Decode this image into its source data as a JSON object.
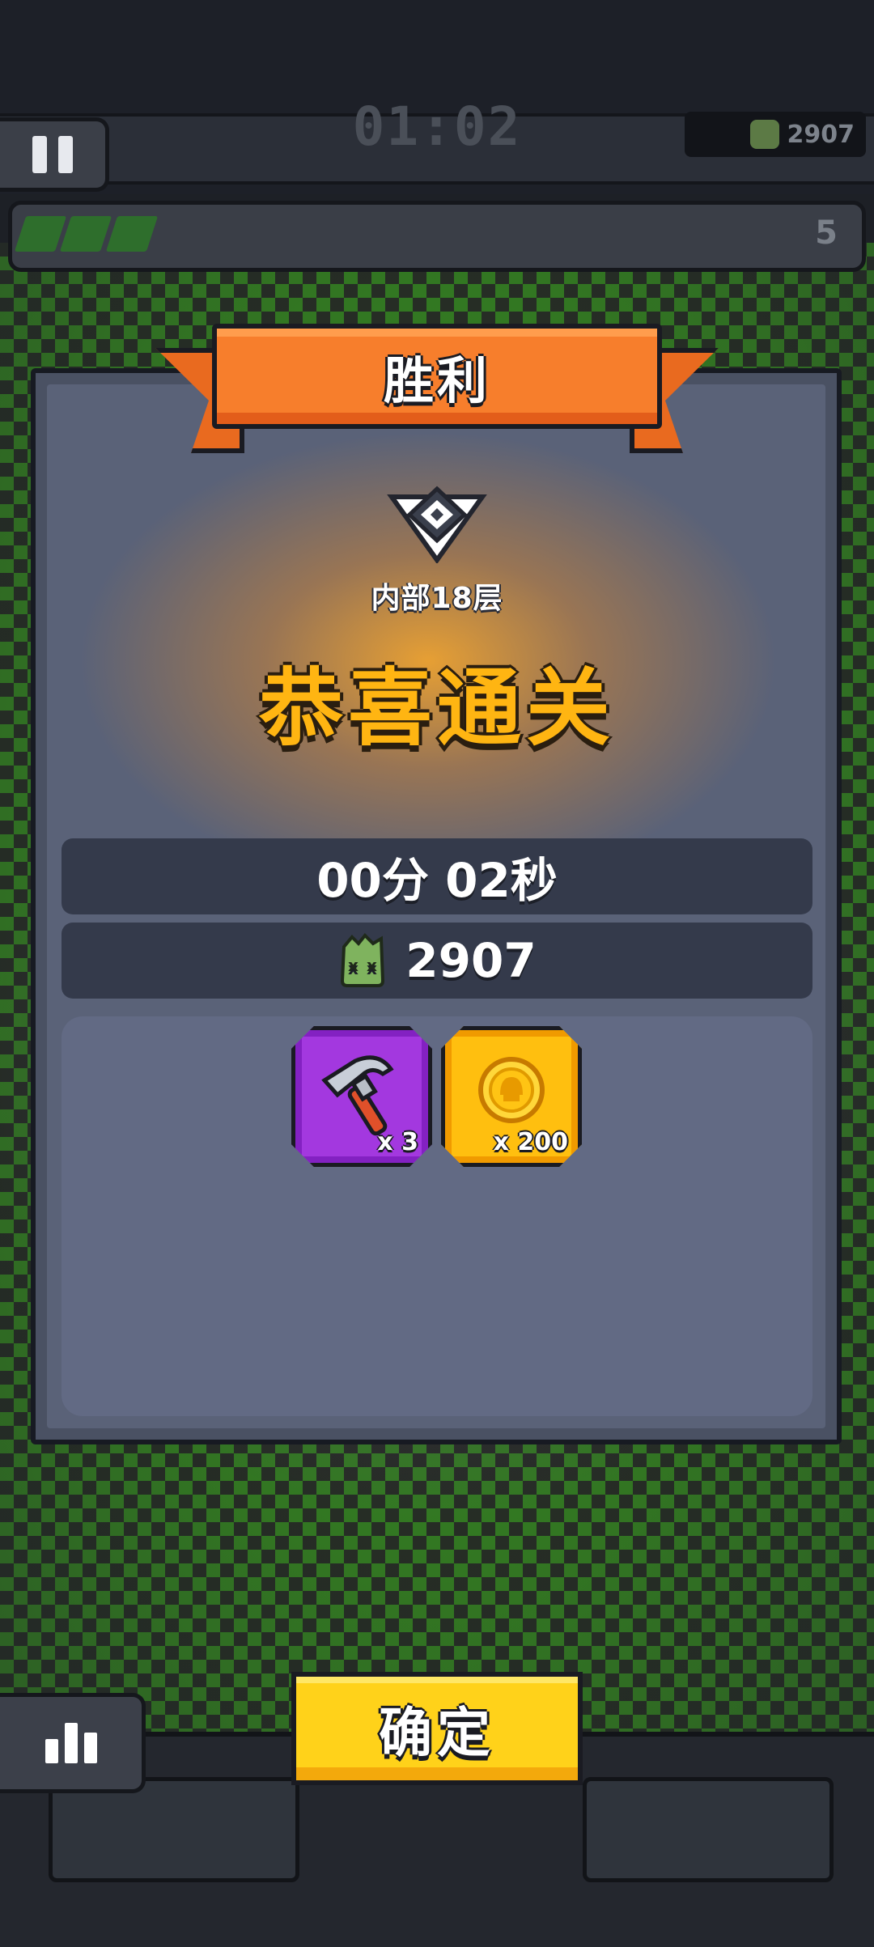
{
  "hud": {
    "timer": "01:02",
    "currency": "2907",
    "wave_number": "5",
    "wave_progress": 0.16
  },
  "dialog": {
    "title": "胜利",
    "level_name": "内部18层",
    "headline": "恭喜通关",
    "time_stat": "00分 02秒",
    "currency_stat": "2907",
    "rewards": [
      {
        "icon": "hammer-icon",
        "quantity": "x 3",
        "rarity_color": "#a338df"
      },
      {
        "icon": "gold-coin-icon",
        "quantity": "x 200",
        "rarity_color": "#ffbf0f"
      }
    ]
  },
  "buttons": {
    "confirm": "确定"
  },
  "icons": {
    "pause": "pause-icon",
    "stats": "bar-chart-icon",
    "rank": "rank-badge-icon",
    "currency": "zombie-head-icon"
  },
  "colors": {
    "ribbon": "#f77e2c",
    "headline": "#ffb512",
    "confirm_button": "#ffd21a",
    "dialog_bg": "#5a6278"
  }
}
